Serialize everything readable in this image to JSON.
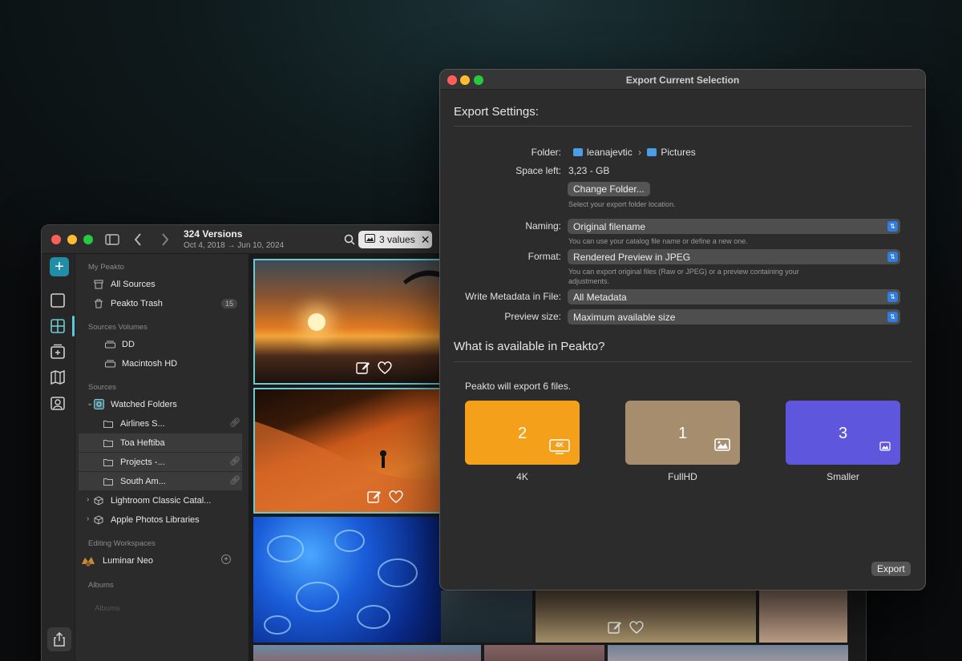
{
  "app": {
    "title": "324 Versions",
    "date_range": "Oct 4, 2018 → Jun 10, 2024",
    "filter_chip": "3 values",
    "sidebar": {
      "my_peakto": "My Peakto",
      "all_sources": "All Sources",
      "trash": "Peakto Trash",
      "trash_count": "15",
      "sources_volumes": "Sources Volumes",
      "volumes": [
        {
          "label": "DD",
          "status": "#e5302a"
        },
        {
          "label": "Macintosh HD",
          "status": "#2fbd3c"
        }
      ],
      "sources": "Sources",
      "watched_folders": "Watched Folders",
      "folders": [
        {
          "label": "Airlines S...",
          "status": "#2fbd3c"
        },
        {
          "label": "Toa Heftiba",
          "status": "#e5302a"
        },
        {
          "label": "Projects -...",
          "status": "#2fbd3c"
        },
        {
          "label": "South Am...",
          "status": "#2fbd3c"
        }
      ],
      "lightroom": "Lightroom Classic Catal...",
      "apple_photos": "Apple Photos Libraries",
      "editing_workspaces": "Editing Workspaces",
      "luminar": "Luminar Neo",
      "albums_head": "Albums",
      "albums_item": "Albums"
    }
  },
  "dialog": {
    "title": "Export Current Selection",
    "settings_heading": "Export Settings:",
    "folder_label": "Folder:",
    "folder_path": [
      "leanajevtic",
      "Pictures"
    ],
    "space_label": "Space left:",
    "space_value": "3,23 - GB",
    "change_folder": "Change Folder...",
    "folder_help": "Select your export folder location.",
    "naming_label": "Naming:",
    "naming_value": "Original filename",
    "naming_help": "You can use your catalog file name or define a new one.",
    "format_label": "Format:",
    "format_value": "Rendered Preview in JPEG",
    "format_help": "You can export original files (Raw or JPEG) or a preview containing your adjustments.",
    "metadata_label": "Write Metadata in File:",
    "metadata_value": "All Metadata",
    "preview_label": "Preview size:",
    "preview_value": "Maximum available size",
    "available_heading": "What is available in Peakto?",
    "export_summary": "Peakto will export 6 files.",
    "tiles": [
      {
        "count": "2",
        "label": "4K",
        "color": "#f5a01a",
        "icon_text": "4K"
      },
      {
        "count": "1",
        "label": "FullHD",
        "color": "#a68d6d"
      },
      {
        "count": "3",
        "label": "Smaller",
        "color": "#5e57de"
      }
    ],
    "export_button": "Export"
  }
}
